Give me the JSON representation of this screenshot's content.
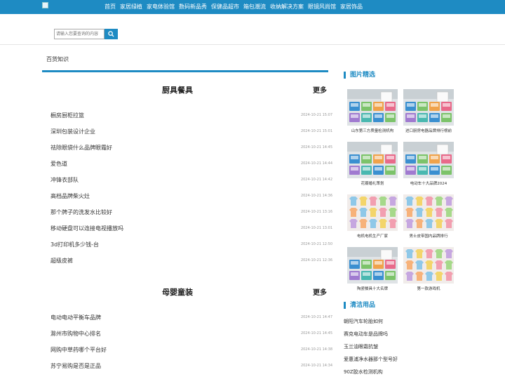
{
  "nav": [
    "首页",
    "家居绿植",
    "家电体验馆",
    "数码新品秀",
    "保健品超市",
    "箱包潮流",
    "收纳解决方案",
    "眼镜风尚馆",
    "家居饰品"
  ],
  "search": {
    "placeholder": "请输入您要查询的内容"
  },
  "breadcrumb": "百货知识",
  "sections": [
    {
      "title": "厨具餐具",
      "more": "更多",
      "items": [
        {
          "title": "橱房厨柜拉篮",
          "date": "2024-10-21 15:07"
        },
        {
          "title": "深圳包装设计企业",
          "date": "2024-10-21 15:01"
        },
        {
          "title": "祛除眼袋什么品牌眼霜好",
          "date": "2024-10-21 14:45"
        },
        {
          "title": "爱色道",
          "date": "2024-10-21 14:44"
        },
        {
          "title": "冲锋衣部队",
          "date": "2024-10-21 14:42"
        },
        {
          "title": "高档品牌柴火灶",
          "date": "2024-10-21 14:36"
        },
        {
          "title": "那个牌子的洗发水比较好",
          "date": "2024-10-21 13:16"
        },
        {
          "title": "移动硬盘可以连接电视播放吗",
          "date": "2024-10-21 13:01"
        },
        {
          "title": "3d打印机多少钱-台",
          "date": "2024-10-21 12:50"
        },
        {
          "title": "超级皮裤",
          "date": "2024-10-21 12:36"
        }
      ]
    },
    {
      "title": "母婴童装",
      "more": "更多",
      "items": [
        {
          "title": "电动电动平衡车品牌",
          "date": "2024-10-21 14:47"
        },
        {
          "title": "滁州市购物中心排名",
          "date": "2024-10-21 14:45"
        },
        {
          "title": "网购中草药哪个平台好",
          "date": "2024-10-21 14:38"
        },
        {
          "title": "苏宁易购是否是正品",
          "date": "2024-10-21 14:34"
        }
      ]
    }
  ],
  "sidebar": {
    "pics_title": "图片精选",
    "pics": [
      {
        "caption": "山东第三方质量检测机构",
        "kind": "bins"
      },
      {
        "caption": "进口厨房电器品牌排行榜前",
        "kind": "bins"
      },
      {
        "caption": "花瓣婚礼策划",
        "kind": "bins"
      },
      {
        "caption": "电动车十大品牌2024",
        "kind": "bins"
      },
      {
        "caption": "电机电机生产厂家",
        "kind": "clothes"
      },
      {
        "caption": "男士皮带国内品牌排行",
        "kind": "clothes"
      },
      {
        "caption": "陶瓷餐具十大名牌",
        "kind": "bins"
      },
      {
        "caption": "第一款游戏机",
        "kind": "clothes"
      }
    ],
    "clean_title": "清洁用品",
    "clean": [
      "朝阳汽车轮胎如何",
      "赛克电动车是品牌吗",
      "玉兰油眼霜抗皱",
      "爱惠浦净水器那个型号好",
      "90Z胶水检测机构"
    ]
  },
  "colors": {
    "accent": "#1e8bc3"
  }
}
